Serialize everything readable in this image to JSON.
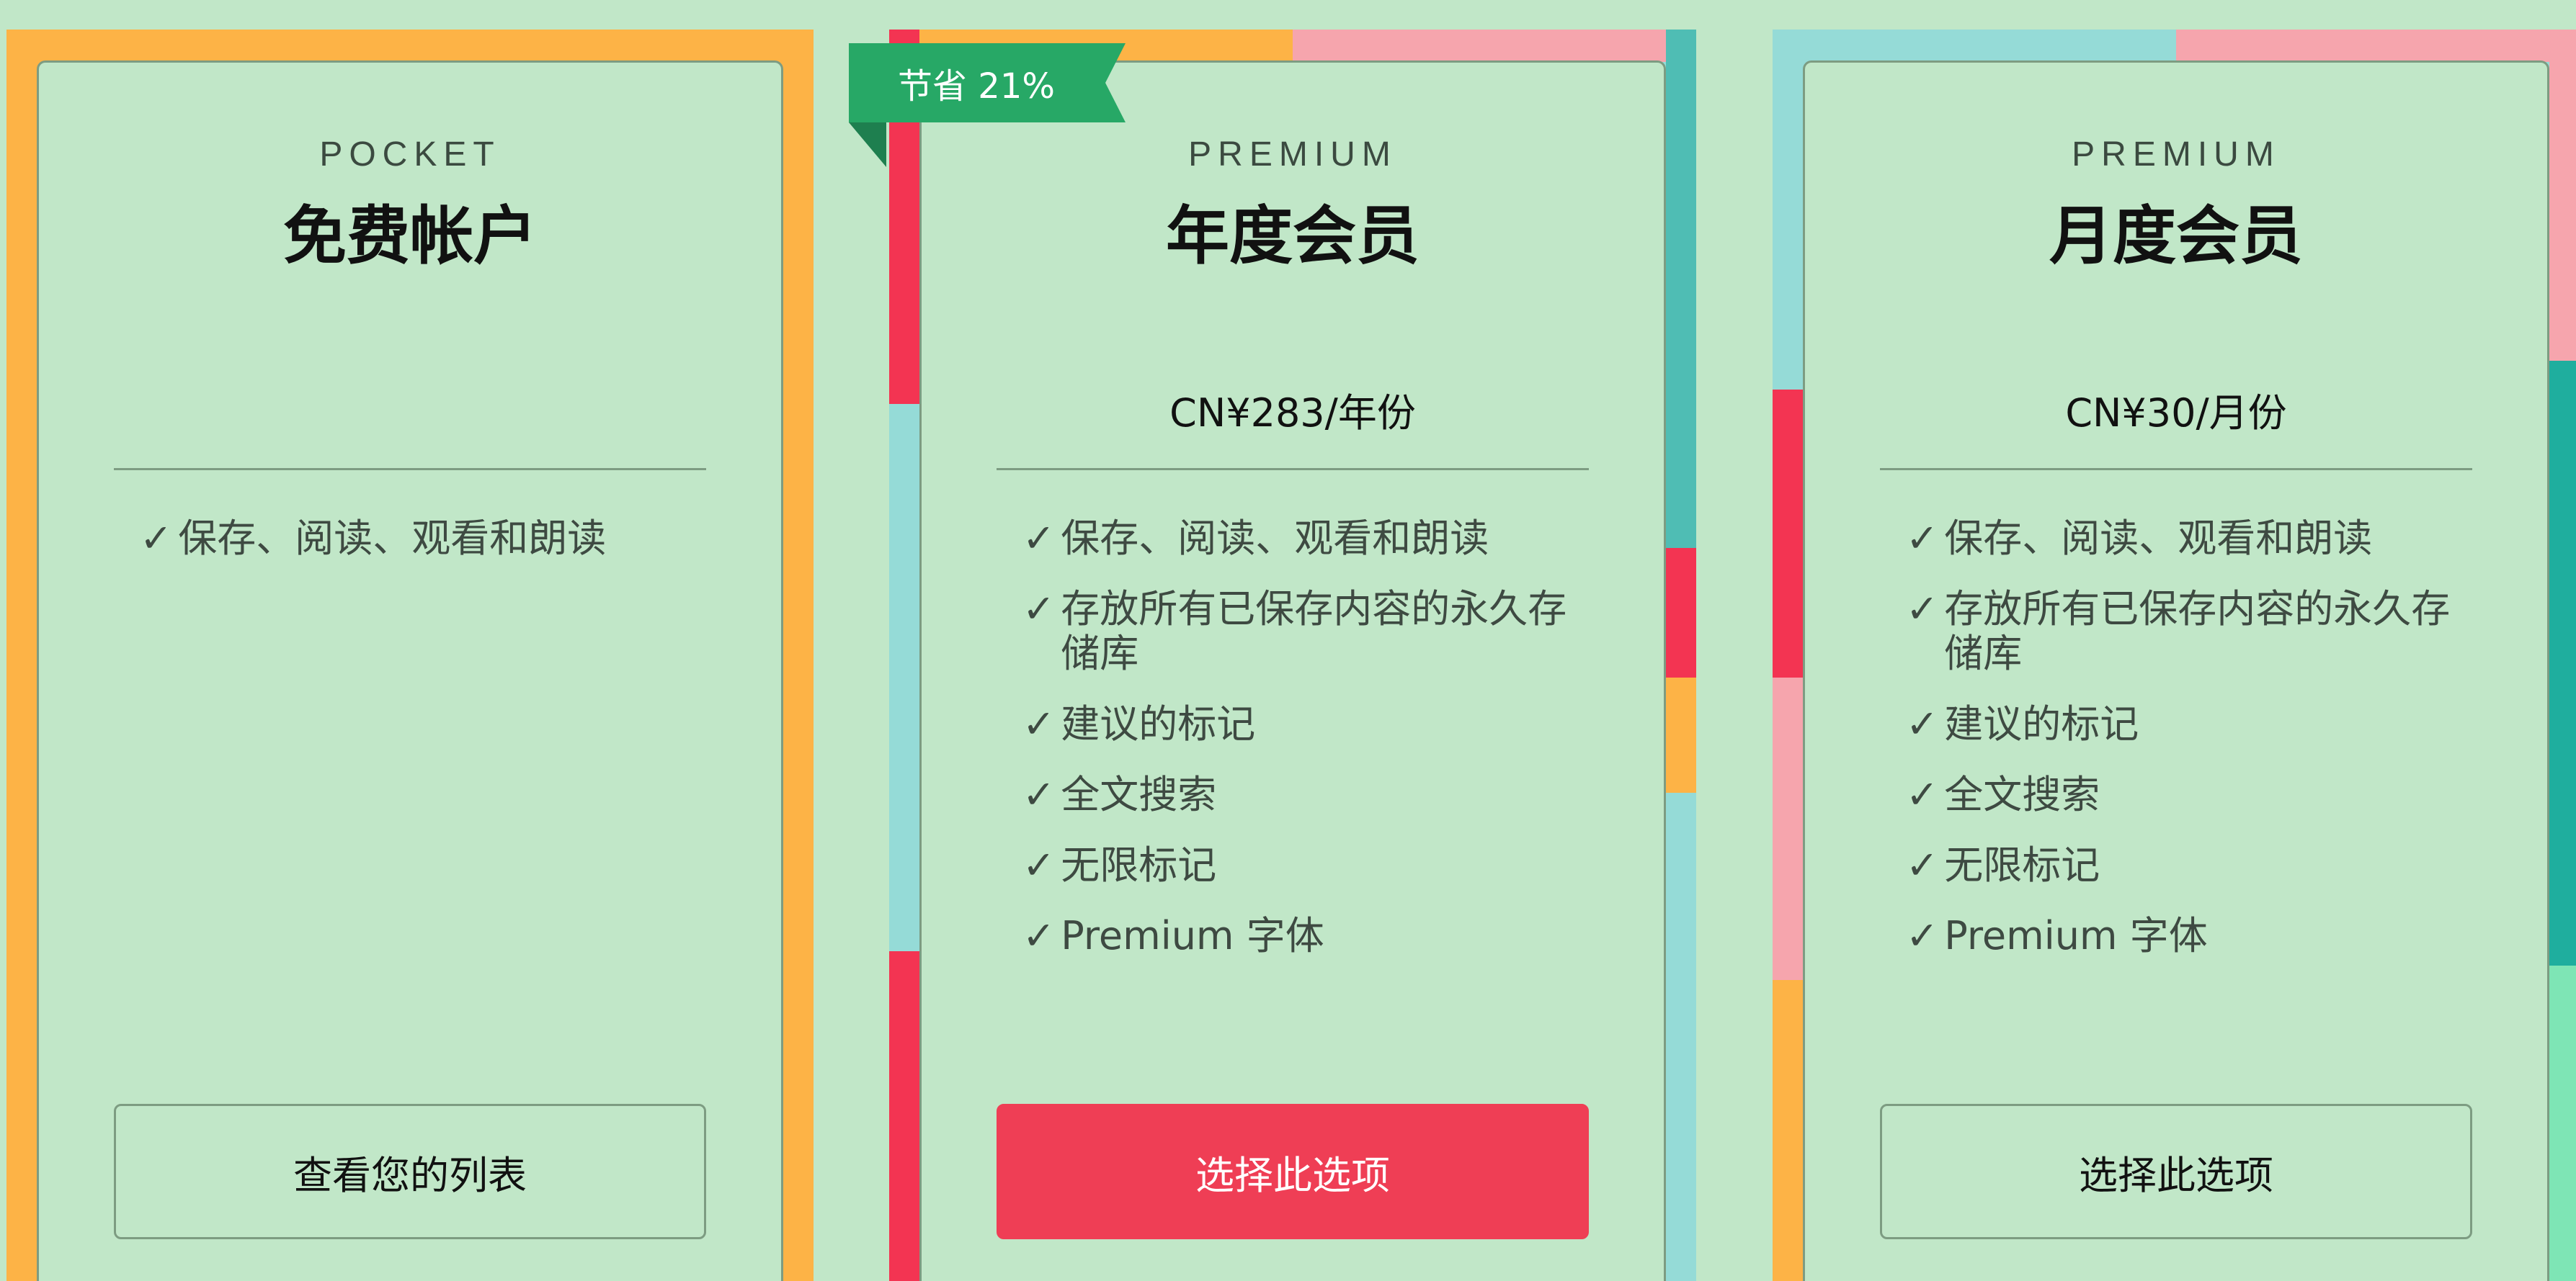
{
  "colors": {
    "background": "#c1e7c8",
    "orange": "#fdb346",
    "teal": "#95dbd7",
    "teal_dark": "#4fbdb4",
    "red": "#f33452",
    "pink": "#f6a5ad",
    "green_badge": "#27a866",
    "button_primary": "#ef3e55",
    "border": "#7d9c82"
  },
  "plans": [
    {
      "tier": "POCKET",
      "name": "免费帐户",
      "price": "",
      "features": [
        "保存、阅读、观看和朗读"
      ],
      "button": "查看您的列表"
    },
    {
      "tier": "PREMIUM",
      "name": "年度会员",
      "price": "CN¥283/年份",
      "badge": "节省 21%",
      "features": [
        "保存、阅读、观看和朗读",
        "存放所有已保存内容的永久存储库",
        "建议的标记",
        "全文搜索",
        "无限标记",
        "Premium 字体"
      ],
      "button": "选择此选项"
    },
    {
      "tier": "PREMIUM",
      "name": "月度会员",
      "price": "CN¥30/月份",
      "features": [
        "保存、阅读、观看和朗读",
        "存放所有已保存内容的永久存储库",
        "建议的标记",
        "全文搜索",
        "无限标记",
        "Premium 字体"
      ],
      "button": "选择此选项"
    }
  ],
  "check_mark": "✓"
}
